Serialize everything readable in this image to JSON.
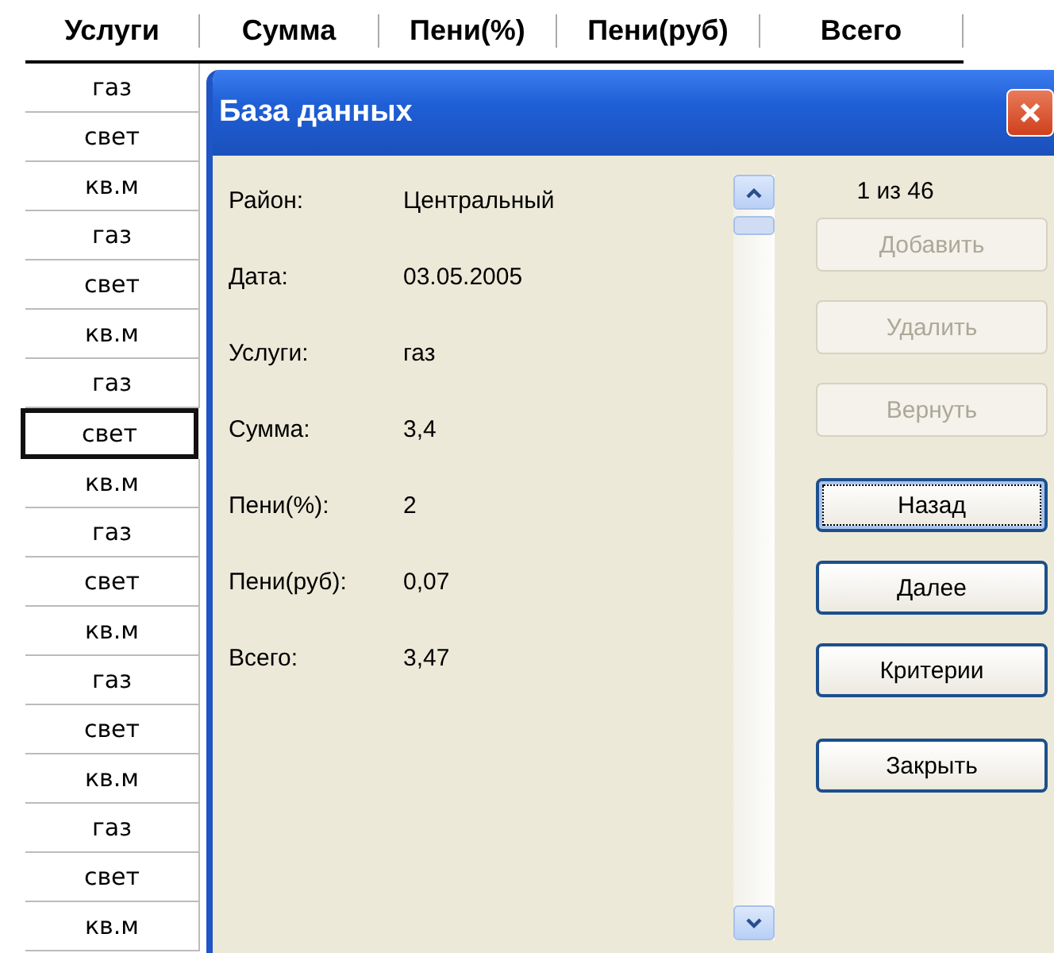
{
  "sheet": {
    "columns": [
      "Услуги",
      "Сумма",
      "Пени(%)",
      "Пени(руб)",
      "Всего"
    ],
    "rows": [
      {
        "value": "газ",
        "selected": false
      },
      {
        "value": "свет",
        "selected": false
      },
      {
        "value": "кв.м",
        "selected": false
      },
      {
        "value": "газ",
        "selected": false
      },
      {
        "value": "свет",
        "selected": false
      },
      {
        "value": "кв.м",
        "selected": false
      },
      {
        "value": "газ",
        "selected": false
      },
      {
        "value": "свет",
        "selected": true
      },
      {
        "value": "кв.м",
        "selected": false
      },
      {
        "value": "газ",
        "selected": false
      },
      {
        "value": "свет",
        "selected": false
      },
      {
        "value": "кв.м",
        "selected": false
      },
      {
        "value": "газ",
        "selected": false
      },
      {
        "value": "свет",
        "selected": false
      },
      {
        "value": "кв.м",
        "selected": false
      },
      {
        "value": "газ",
        "selected": false
      },
      {
        "value": "свет",
        "selected": false
      },
      {
        "value": "кв.м",
        "selected": false
      }
    ]
  },
  "dialog": {
    "title": "База данных",
    "fields": [
      {
        "label": "Район:",
        "value": "Центральный"
      },
      {
        "label": "Дата:",
        "value": "03.05.2005"
      },
      {
        "label": "Услуги:",
        "value": "газ"
      },
      {
        "label": "Сумма:",
        "value": "3,4"
      },
      {
        "label": "Пени(%):",
        "value": "2"
      },
      {
        "label": "Пени(руб):",
        "value": "0,07"
      },
      {
        "label": "Всего:",
        "value": "3,47"
      }
    ],
    "counter": "1 из 46",
    "buttons": [
      {
        "label": "Добавить",
        "disabled": true,
        "focused": false
      },
      {
        "label": "Удалить",
        "disabled": true,
        "focused": false
      },
      {
        "label": "Вернуть",
        "disabled": true,
        "focused": false
      },
      {
        "label": "Назад",
        "disabled": false,
        "focused": true
      },
      {
        "label": "Далее",
        "disabled": false,
        "focused": false
      },
      {
        "label": "Критерии",
        "disabled": false,
        "focused": false
      },
      {
        "label": "Закрыть",
        "disabled": false,
        "focused": false
      }
    ]
  }
}
